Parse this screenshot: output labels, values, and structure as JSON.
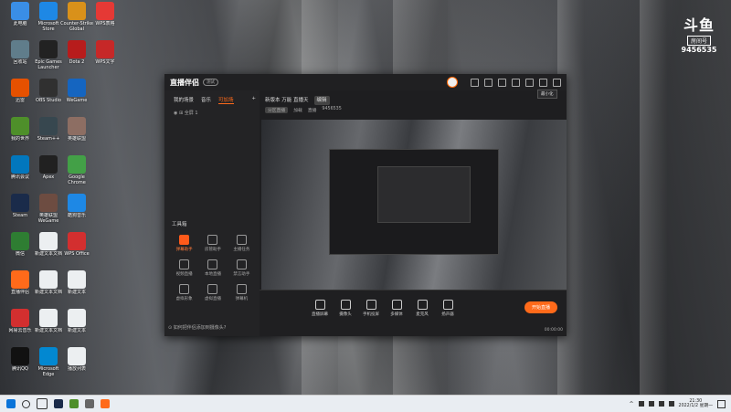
{
  "desktop": {
    "icons": [
      {
        "label": "此电脑",
        "color": "#3a8ee6",
        "col": 0,
        "row": 0
      },
      {
        "label": "Microsoft Store",
        "color": "#1e88e5",
        "col": 1,
        "row": 0
      },
      {
        "label": "Counter-Strike Global",
        "color": "#d9911a",
        "col": 2,
        "row": 0
      },
      {
        "label": "WPS表格",
        "color": "#e53935",
        "col": 3,
        "row": 0
      },
      {
        "label": "回收站",
        "color": "#607d8b",
        "col": 0,
        "row": 1
      },
      {
        "label": "Epic Games Launcher",
        "color": "#222222",
        "col": 1,
        "row": 1
      },
      {
        "label": "Dota 2",
        "color": "#b71c1c",
        "col": 2,
        "row": 1
      },
      {
        "label": "WPS文字",
        "color": "#c62828",
        "col": 3,
        "row": 1
      },
      {
        "label": "迅雷",
        "color": "#e65100",
        "col": 0,
        "row": 2
      },
      {
        "label": "OBS Studio",
        "color": "#303030",
        "col": 1,
        "row": 2
      },
      {
        "label": "WeGame",
        "color": "#1565c0",
        "col": 2,
        "row": 2
      },
      {
        "label": "我的世界",
        "color": "#4e8f2a",
        "col": 0,
        "row": 3
      },
      {
        "label": "Steam++",
        "color": "#37474f",
        "col": 1,
        "row": 3
      },
      {
        "label": "英雄联盟",
        "color": "#8d6e63",
        "col": 2,
        "row": 3
      },
      {
        "label": "腾讯会议",
        "color": "#0277bd",
        "col": 0,
        "row": 4
      },
      {
        "label": "Apex",
        "color": "#212121",
        "col": 1,
        "row": 4
      },
      {
        "label": "Google Chrome",
        "color": "#43a047",
        "col": 2,
        "row": 4
      },
      {
        "label": "Steam",
        "color": "#1a2b4a",
        "col": 0,
        "row": 5
      },
      {
        "label": "英雄联盟WeGame",
        "color": "#6d4c41",
        "col": 1,
        "row": 5
      },
      {
        "label": "酷狗音乐",
        "color": "#1e88e5",
        "col": 2,
        "row": 5
      },
      {
        "label": "微信",
        "color": "#2e7d32",
        "col": 0,
        "row": 6
      },
      {
        "label": "新建文本文档",
        "color": "#eceff1",
        "col": 1,
        "row": 6
      },
      {
        "label": "WPS Office",
        "color": "#d32f2f",
        "col": 2,
        "row": 6
      },
      {
        "label": "直播伴侣",
        "color": "#ff6a1a",
        "col": 0,
        "row": 7
      },
      {
        "label": "新建文本文档",
        "color": "#eceff1",
        "col": 1,
        "row": 7
      },
      {
        "label": "新建文本",
        "color": "#eceff1",
        "col": 2,
        "row": 7
      },
      {
        "label": "网易云音乐",
        "color": "#d32f2f",
        "col": 0,
        "row": 8
      },
      {
        "label": "新建文本文档",
        "color": "#eceff1",
        "col": 1,
        "row": 8
      },
      {
        "label": "新建文本",
        "color": "#eceff1",
        "col": 2,
        "row": 8
      },
      {
        "label": "腾讯QQ",
        "color": "#111111",
        "col": 0,
        "row": 9
      },
      {
        "label": "Microsoft Edge",
        "color": "#0288d1",
        "col": 1,
        "row": 9
      },
      {
        "label": "播放列表",
        "color": "#eceff1",
        "col": 2,
        "row": 9
      }
    ]
  },
  "douyu": {
    "logo": "斗鱼",
    "room_label": "房间号",
    "room_number": "9456535"
  },
  "app": {
    "title": "直播伴侣",
    "badge": "测试",
    "sidebar_tabs": [
      "我的场景",
      "音乐",
      "可加场"
    ],
    "scene_label": "全屏 1",
    "toolbox_title": "工具箱",
    "tools": [
      {
        "label": "弹幕助手",
        "hot": true
      },
      {
        "label": "房管助手",
        "hot": false
      },
      {
        "label": "主播任务",
        "hot": false
      },
      {
        "label": "视频直播",
        "hot": false
      },
      {
        "label": "本地直播",
        "hot": false
      },
      {
        "label": "禁言助手",
        "hot": false
      },
      {
        "label": "虚拟形象",
        "hot": false
      },
      {
        "label": "虚拟直播",
        "hot": false
      },
      {
        "label": "弹幕机",
        "hot": false
      }
    ],
    "hint": "如何把伴侣添加到摄像头?",
    "top_line": {
      "title": "新版本 万能 直播天",
      "chip": "编辑"
    },
    "info_line": {
      "category": "分区直播",
      "a": "加载",
      "b": "直播",
      "count": "9456535"
    },
    "tooltip": "最小化",
    "controls": [
      "直播屏幕",
      "摄像头",
      "手机投屏",
      "多媒体",
      "麦克风",
      "扬声器"
    ],
    "time": "00:00:00",
    "live_button": "开始直播"
  },
  "taskbar": {
    "time": "21:30",
    "date": "2022/1/2 星期一"
  }
}
